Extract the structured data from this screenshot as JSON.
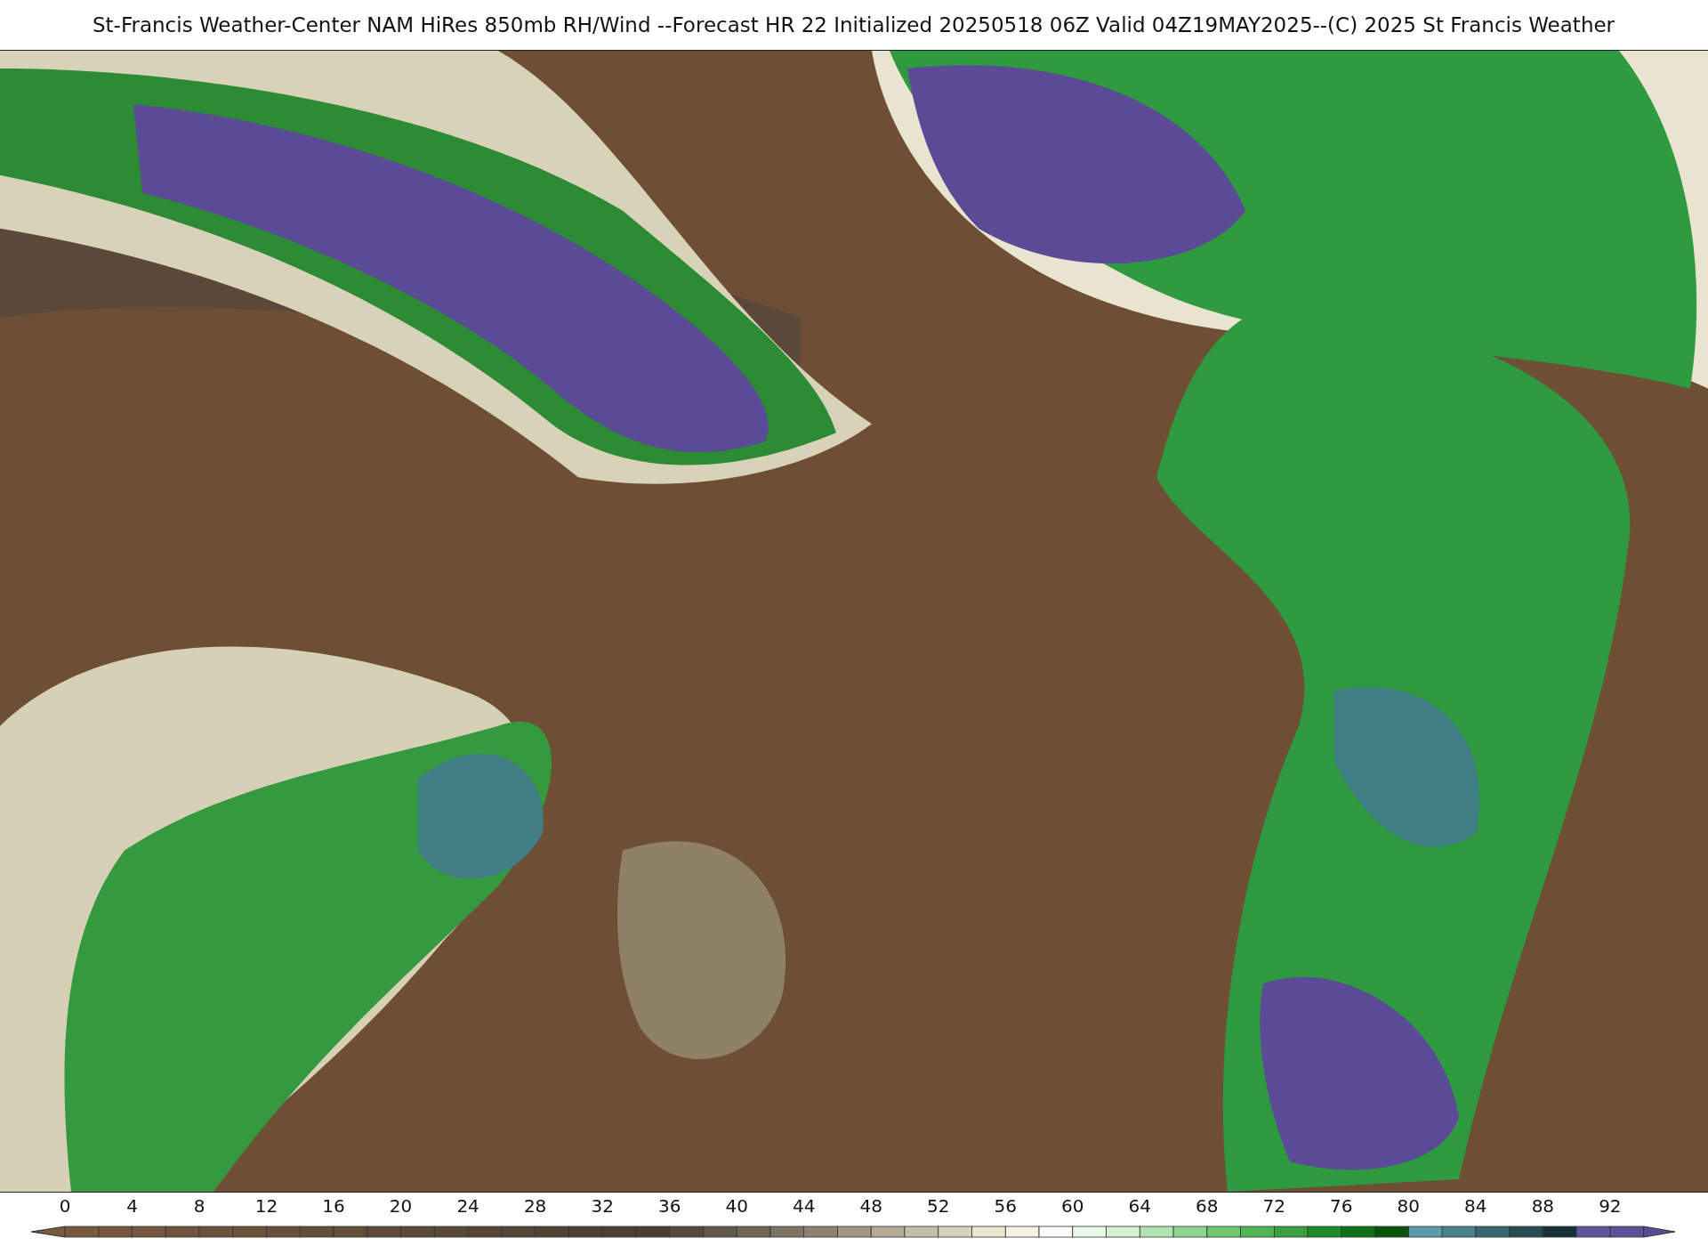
{
  "title": "St-Francis Weather-Center NAM HiRes 850mb RH/Wind  --Forecast HR 22 Initialized 20250518 06Z Valid 04Z19MAY2025--(C) 2025 St Francis Weather",
  "colorbar": {
    "ticks": [
      "0",
      "4",
      "8",
      "12",
      "16",
      "20",
      "24",
      "28",
      "32",
      "36",
      "40",
      "44",
      "48",
      "52",
      "56",
      "60",
      "64",
      "68",
      "72",
      "76",
      "80",
      "84",
      "88",
      "92"
    ]
  }
}
